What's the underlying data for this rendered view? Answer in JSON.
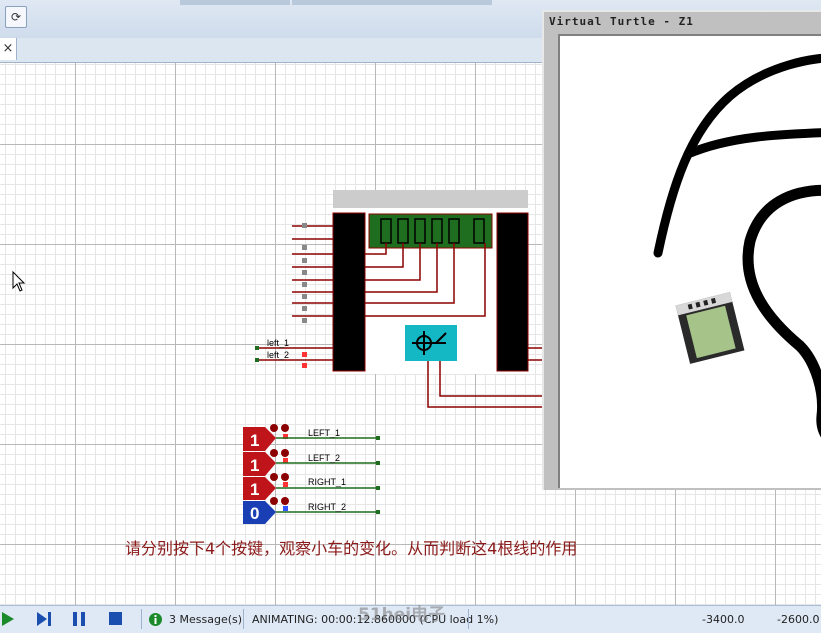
{
  "window": {
    "toolbar_icon": "refresh-doc-icon",
    "tab_close": "×"
  },
  "turtle": {
    "title": "Virtual Turtle - Z1"
  },
  "circuit": {
    "net_labels_in": [
      "left_1",
      "left_2"
    ],
    "logic_states": [
      {
        "value": "1",
        "label": "LEFT_1",
        "color": "#c0141b"
      },
      {
        "value": "1",
        "label": "LEFT_2",
        "color": "#c0141b"
      },
      {
        "value": "1",
        "label": "RIGHT_1",
        "color": "#c0141b"
      },
      {
        "value": "0",
        "label": "RIGHT_2",
        "color": "#1a3fb5"
      }
    ]
  },
  "instruction": "请分别按下4个按键，观察小车的变化。从而判断这4根线的作用",
  "status": {
    "messages": "3 Message(s)",
    "animating": "ANIMATING: 00:00:12.860000 (CPU load 1%)",
    "coord_x": "-3400.0",
    "coord_y": "-2600.0"
  },
  "watermark": "51hei电子",
  "colors": {
    "wire": "#8b0000",
    "pin_high": "#ff3333",
    "pin_low": "#3355ff",
    "chip": "#cc9a9a",
    "lcd": "#1f6e1f",
    "servo": "#13b8c4"
  }
}
